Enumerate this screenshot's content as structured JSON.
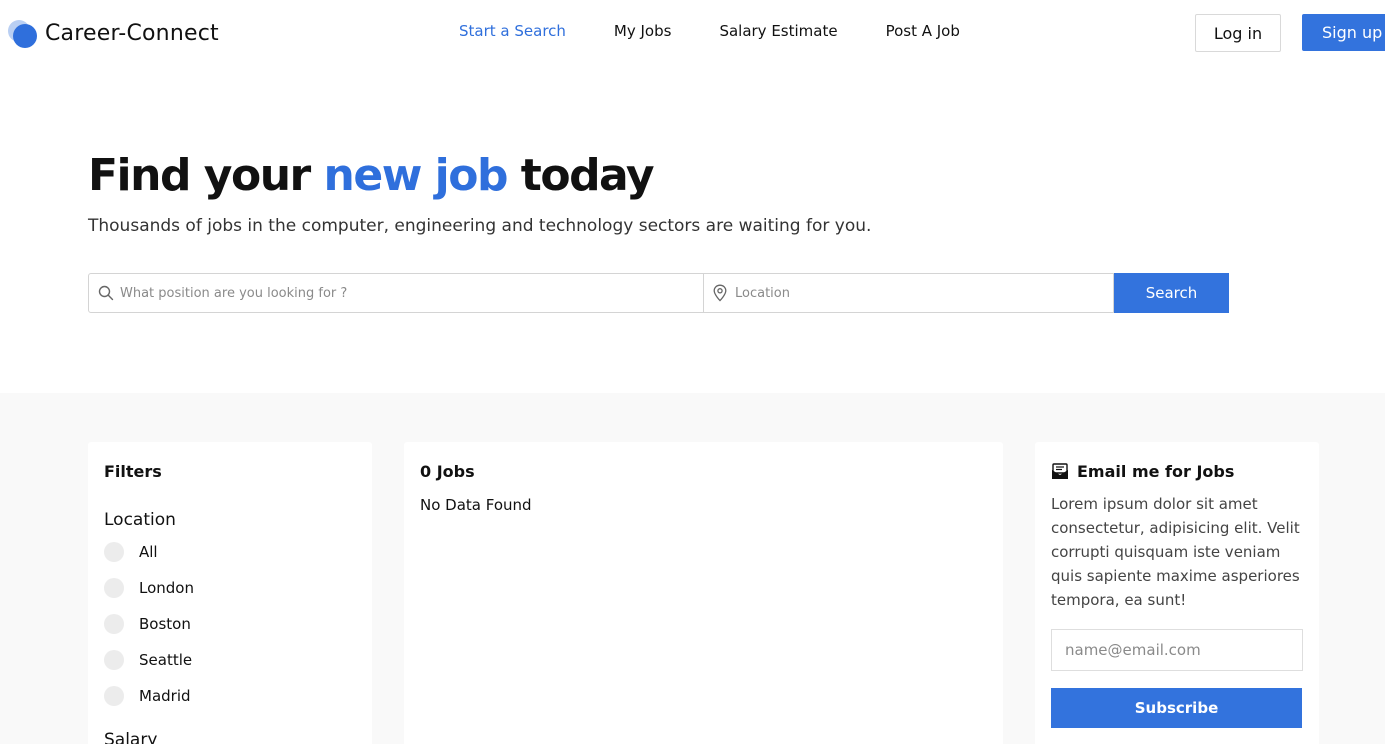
{
  "header": {
    "brand": "Career-Connect",
    "nav": [
      {
        "label": "Start a Search",
        "active": true
      },
      {
        "label": "My Jobs",
        "active": false
      },
      {
        "label": "Salary Estimate",
        "active": false
      },
      {
        "label": "Post A Job",
        "active": false
      }
    ],
    "login_label": "Log in",
    "signup_label": "Sign up"
  },
  "hero": {
    "title_prefix": "Find your ",
    "title_accent": "new job",
    "title_suffix": " today",
    "subtitle": "Thousands of jobs in the computer, engineering and technology sectors are waiting for you.",
    "position_placeholder": "What position are you looking for ?",
    "position_value": "",
    "location_placeholder": "Location",
    "location_value": "",
    "search_label": "Search"
  },
  "filters": {
    "title": "Filters",
    "location_title": "Location",
    "locations": [
      "All",
      "London",
      "Boston",
      "Seattle",
      "Madrid"
    ],
    "salary_title": "Salary"
  },
  "jobs": {
    "count_label": "0 Jobs",
    "empty_text": "No Data Found"
  },
  "email": {
    "title": "Email me for Jobs",
    "description": "Lorem ipsum dolor sit amet consectetur, adipisicing elit. Velit corrupti quisquam iste veniam quis sapiente maxime asperiores tempora, ea sunt!",
    "input_placeholder": "name@email.com",
    "input_value": "",
    "subscribe_label": "Subscribe"
  },
  "colors": {
    "accent": "#3373dd",
    "section_bg": "#f9f9f9"
  },
  "icons": {
    "logo": "logo-icon",
    "search": "search-icon",
    "location": "map-pin-icon",
    "email": "mail-icon"
  }
}
